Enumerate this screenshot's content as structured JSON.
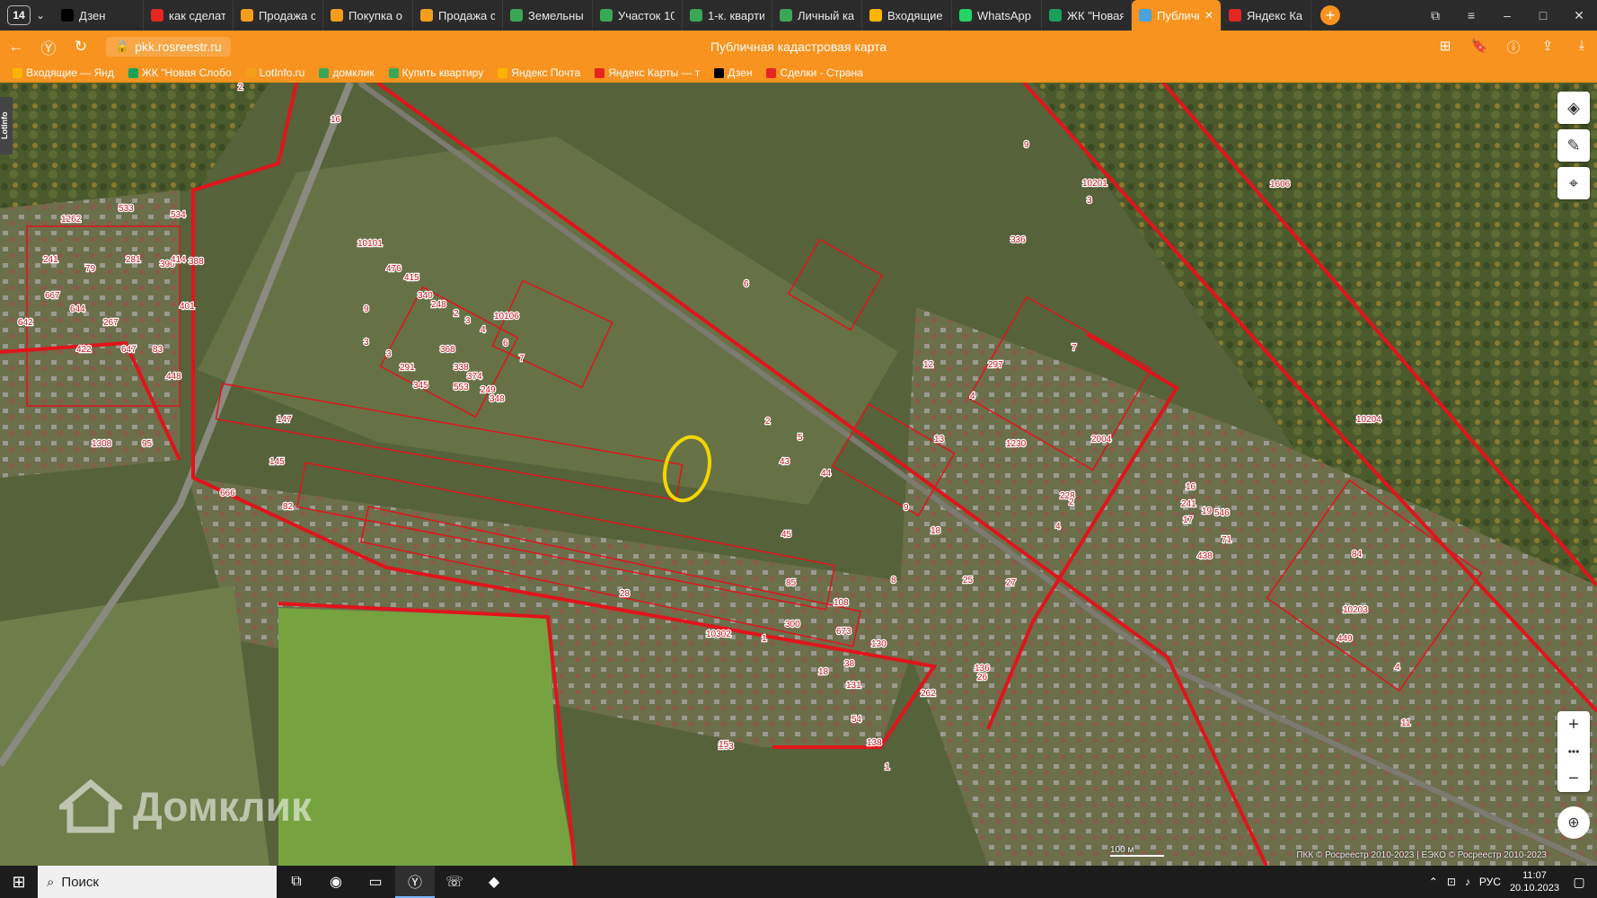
{
  "browser": {
    "tab_count": "14",
    "tabs": [
      {
        "title": "Дзен",
        "color": "#000000"
      },
      {
        "title": "как сделать",
        "color": "#e52620"
      },
      {
        "title": "Продажа с",
        "color": "#f59e1b"
      },
      {
        "title": "Покупка о",
        "color": "#f59e1b"
      },
      {
        "title": "Продажа с",
        "color": "#f59e1b"
      },
      {
        "title": "Земельны",
        "color": "#3aa757"
      },
      {
        "title": "Участок 10",
        "color": "#3aa757"
      },
      {
        "title": "1-к. кварти",
        "color": "#3aa757"
      },
      {
        "title": "Личный ка",
        "color": "#3aa757"
      },
      {
        "title": "Входящие",
        "color": "#fcb400"
      },
      {
        "title": "WhatsApp",
        "color": "#25d366"
      },
      {
        "title": "ЖК \"Новая",
        "color": "#1aa05a"
      },
      {
        "title": "Публичн",
        "color": "#4aa3df",
        "active": true
      },
      {
        "title": "Яндекс Кар",
        "color": "#e52620"
      }
    ],
    "url": "pkk.rosreestr.ru",
    "page_title": "Публичная кадастровая карта",
    "bookmarks": [
      {
        "label": "Входящие — Янд",
        "color": "#fcb400"
      },
      {
        "label": "ЖК \"Новая Слобо",
        "color": "#1aa05a"
      },
      {
        "label": "LotInfo.ru",
        "color": "#f59e1b"
      },
      {
        "label": "домклик",
        "color": "#3aa757"
      },
      {
        "label": "Купить квартиру",
        "color": "#3aa757"
      },
      {
        "label": "Яндекс Почта",
        "color": "#fcb400"
      },
      {
        "label": "Яндекс Карты — т",
        "color": "#e52620"
      },
      {
        "label": "Дзен",
        "color": "#000000"
      },
      {
        "label": "Сделки - Страна",
        "color": "#e52620"
      }
    ]
  },
  "map": {
    "lotinfo_label": "LotInfo",
    "watermark": "Домклик",
    "scale_label": "100 м",
    "copyright": "ПКК © Росреестр 2010-2023 | ЕЭКО © Росреестр 2010-2023",
    "zoom_in": "+",
    "zoom_more": "•••",
    "zoom_out": "−",
    "colors": {
      "boundary": "#e0141c",
      "highlight": "#f2d600"
    },
    "parcel_labels": [
      "2",
      "16",
      "1262",
      "533",
      "534",
      "241",
      "79",
      "281",
      "390",
      "388",
      "414",
      "667",
      "644",
      "267",
      "642",
      "422",
      "647",
      "83",
      "448",
      "401",
      "9",
      "10201",
      "3",
      "1606",
      "10101",
      "476",
      "415",
      "340",
      "248",
      "9",
      "2",
      "10106",
      "3",
      "4",
      "6",
      "7",
      "6",
      "3",
      "3",
      "291",
      "345",
      "368",
      "338",
      "374",
      "249",
      "348",
      "553",
      "336",
      "7",
      "12",
      "297",
      "2004",
      "10204",
      "4",
      "1230",
      "13",
      "228",
      "4",
      "2",
      "2",
      "5",
      "43",
      "44",
      "45",
      "9",
      "18",
      "8",
      "25",
      "136",
      "26",
      "27",
      "147",
      "145",
      "666",
      "95",
      "1308",
      "82",
      "108",
      "673",
      "38",
      "130",
      "131",
      "262",
      "138",
      "263",
      "28",
      "10302",
      "1",
      "85",
      "438",
      "84",
      "449",
      "4",
      "10203",
      "71",
      "546",
      "241",
      "17",
      "11",
      "16",
      "19",
      "15",
      "300",
      "18",
      "54",
      "1"
    ]
  },
  "taskbar": {
    "search_placeholder": "Поиск",
    "lang": "РУС",
    "time": "11:07",
    "date": "20.10.2023"
  }
}
